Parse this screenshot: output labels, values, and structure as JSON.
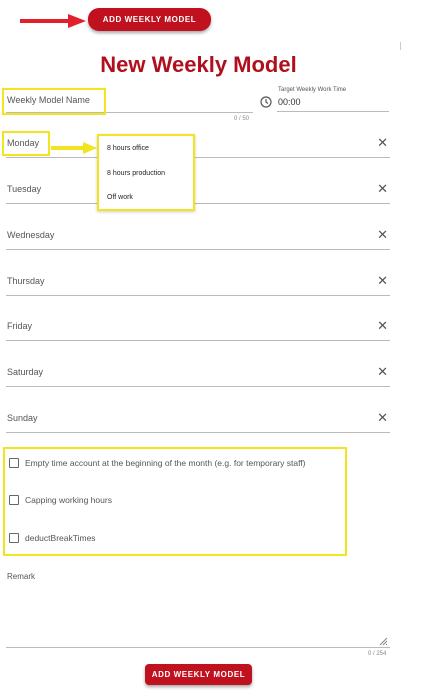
{
  "header": {
    "top_button_label": "ADD WEEKLY MODEL",
    "title": "New Weekly Model"
  },
  "form": {
    "name_placeholder": "Weekly Model Name",
    "name_counter": "0 / 50",
    "target_time_label": "Target Weekly Work Time",
    "target_time_value": "00:00"
  },
  "days": [
    {
      "label": "Monday"
    },
    {
      "label": "Tuesday"
    },
    {
      "label": "Wednesday"
    },
    {
      "label": "Thursday"
    },
    {
      "label": "Friday"
    },
    {
      "label": "Saturday"
    },
    {
      "label": "Sunday"
    }
  ],
  "dropdown": {
    "options": [
      "8 hours office",
      "8 hours production",
      "Off work"
    ]
  },
  "options": {
    "checkboxes": [
      {
        "label": "Empty time account at the beginning of the month (e.g. for temporary staff)",
        "checked": false
      },
      {
        "label": "Capping working hours",
        "checked": false
      },
      {
        "label": "deductBreakTimes",
        "checked": false
      }
    ]
  },
  "remark": {
    "label": "Remark",
    "counter": "0 / 254"
  },
  "footer": {
    "bottom_button_label": "ADD WEEKLY MODEL"
  },
  "colors": {
    "brand_red": "#c0111f",
    "title_red": "#b0101e",
    "highlight_yellow": "#f2e41f",
    "annotation_arrow_red": "#e0202b"
  }
}
